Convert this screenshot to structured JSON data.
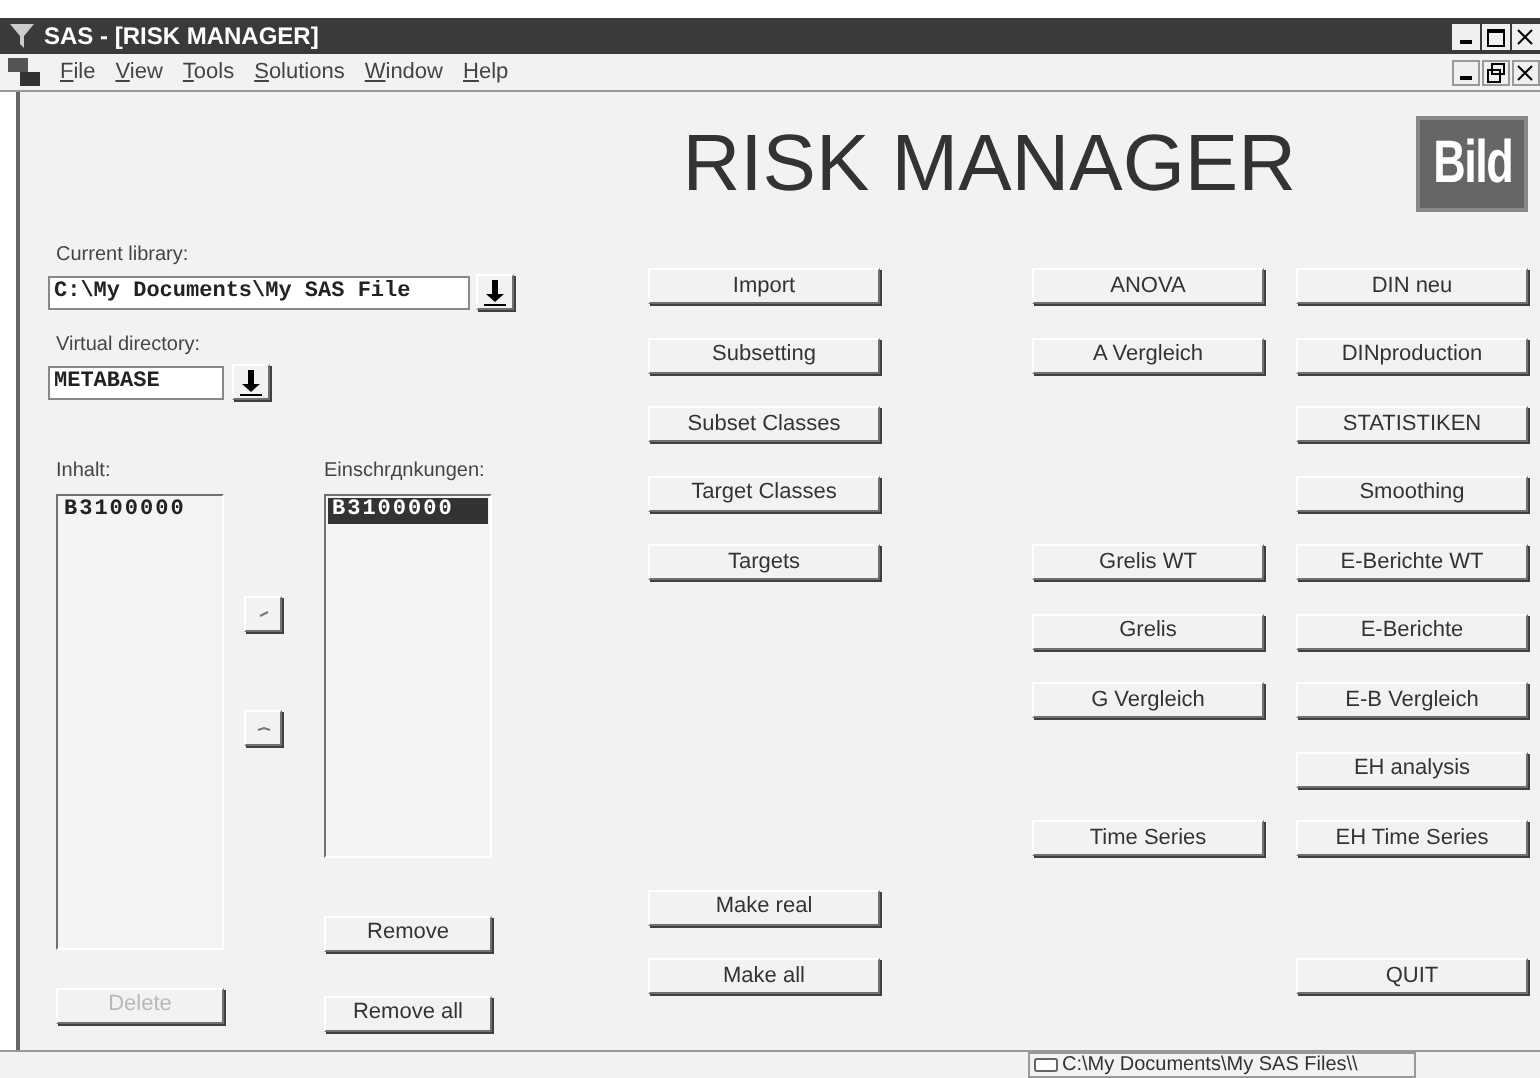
{
  "window": {
    "title": "SAS - [RISK MANAGER]"
  },
  "menu": [
    "File",
    "View",
    "Tools",
    "Solutions",
    "Window",
    "Help"
  ],
  "header": {
    "title": "RISK MANAGER",
    "logo": "Bild"
  },
  "library": {
    "label": "Current library:",
    "value": "C:\\My Documents\\My SAS File"
  },
  "directory": {
    "label": "Virtual directory:",
    "value": "METABASE"
  },
  "content_list": {
    "label": "Inhalt:",
    "items": [
      {
        "text": "B3100000",
        "selected": false
      }
    ]
  },
  "restriction_list": {
    "label": "Einschrдnkungen:",
    "items": [
      {
        "text": "B3100000",
        "selected": true
      }
    ]
  },
  "left_buttons": [
    {
      "label": "Remove",
      "disabled": false
    },
    {
      "label": "Remove all",
      "disabled": false
    },
    {
      "label": "Delete",
      "disabled": true
    }
  ],
  "columns": [
    {
      "items": [
        {
          "kind": "button",
          "label": "Import"
        },
        {
          "kind": "button",
          "label": "Subsetting"
        },
        {
          "kind": "button",
          "label": "Subset Classes"
        },
        {
          "kind": "button",
          "label": "Target Classes"
        },
        {
          "kind": "button",
          "label": "Targets"
        },
        {
          "kind": "gap"
        },
        {
          "kind": "gap"
        },
        {
          "kind": "gap"
        },
        {
          "kind": "gap"
        },
        {
          "kind": "button",
          "label": "Make real"
        },
        {
          "kind": "button",
          "label": "Make all"
        }
      ]
    },
    {
      "items": [
        {
          "kind": "button",
          "label": "ANOVA"
        },
        {
          "kind": "button",
          "label": "A Vergleich"
        },
        {
          "kind": "gap"
        },
        {
          "kind": "gap"
        },
        {
          "kind": "button",
          "label": "Grelis WT"
        },
        {
          "kind": "button",
          "label": "Grelis"
        },
        {
          "kind": "button",
          "label": "G Vergleich"
        },
        {
          "kind": "gap"
        },
        {
          "kind": "button",
          "label": "Time Series"
        }
      ]
    },
    {
      "items": [
        {
          "kind": "button",
          "label": "DIN neu"
        },
        {
          "kind": "button",
          "label": "DINproduction"
        },
        {
          "kind": "button",
          "label": "STATISTIKEN"
        },
        {
          "kind": "button",
          "label": "Smoothing"
        },
        {
          "kind": "button",
          "label": "E-Berichte WT"
        },
        {
          "kind": "button",
          "label": "E-Berichte"
        },
        {
          "kind": "button",
          "label": "E-B Vergleich"
        },
        {
          "kind": "button",
          "label": "EH analysis"
        },
        {
          "kind": "button",
          "label": "EH Time Series"
        },
        {
          "kind": "gap"
        },
        {
          "kind": "button",
          "label": "QUIT"
        }
      ]
    }
  ],
  "status_bar": {
    "path": "C:\\My Documents\\My SAS Files\\\\"
  }
}
